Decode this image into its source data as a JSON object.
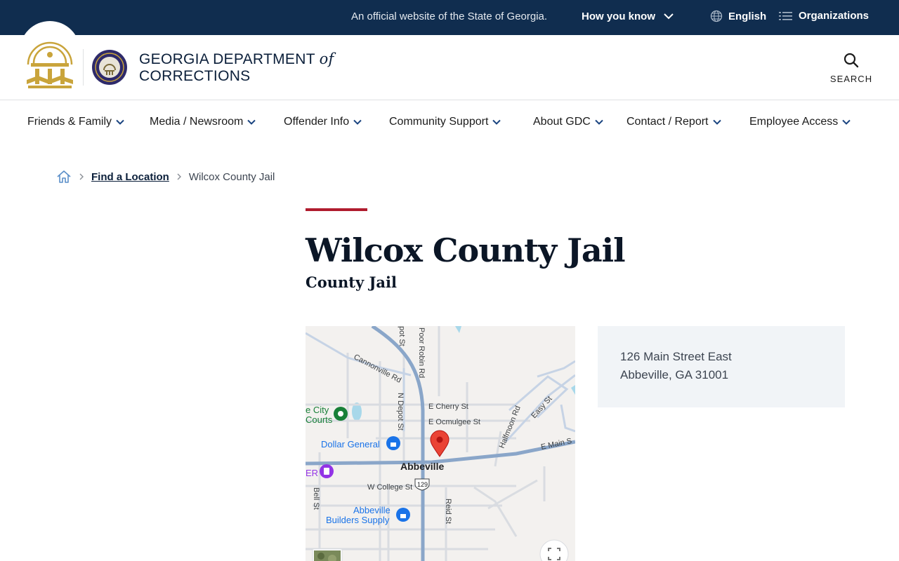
{
  "banner": {
    "official_text": "An official website of the State of Georgia.",
    "how_you_know": "How you know",
    "language": "English",
    "organizations": "Organizations"
  },
  "header": {
    "agency_line1": "GEORGIA DEPARTMENT",
    "agency_of": "of",
    "agency_line2": "CORRECTIONS",
    "search_label": "SEARCH"
  },
  "nav": {
    "items": [
      {
        "label": "Friends & Family"
      },
      {
        "label": "Media / Newsroom"
      },
      {
        "label": "Offender Info"
      },
      {
        "label": "Community Support"
      },
      {
        "label": "About GDC"
      },
      {
        "label": "Contact / Report"
      },
      {
        "label": "Employee Access"
      }
    ]
  },
  "breadcrumb": {
    "parent": "Find a Location",
    "current": "Wilcox County Jail"
  },
  "page": {
    "title": "Wilcox County Jail",
    "subtitle": "County Jail"
  },
  "map": {
    "labels": {
      "cannonville": "Cannonville Rd",
      "poor_robin": "Poor Robin Rd",
      "depot_top": "pot St",
      "n_depot": "N Depot St",
      "e_cherry": "E Cherry St",
      "e_ocmulgee": "E Ocmulgee St",
      "halfmoon": "Halfmoon Rd",
      "easy": "Easy St",
      "e_main": "E Main S",
      "city_courts_1": "e City",
      "city_courts_2": "Courts",
      "dollar_general": "Dollar General",
      "abbeville": "Abbeville",
      "er": "ER",
      "w_college": "W College St",
      "route": "129",
      "bell": "Bell St",
      "reid": "Reid St",
      "builders_1": "Abbeville",
      "builders_2": "Builders Supply"
    }
  },
  "address": {
    "street": "126 Main Street East",
    "city_state_zip": "Abbeville, GA 31001"
  },
  "colors": {
    "banner_bg": "#102d4f",
    "accent_red": "#b01c2e",
    "seal_gold": "#c9a43b",
    "navy": "#0b1f3a",
    "address_bg": "#f1f4f7"
  }
}
